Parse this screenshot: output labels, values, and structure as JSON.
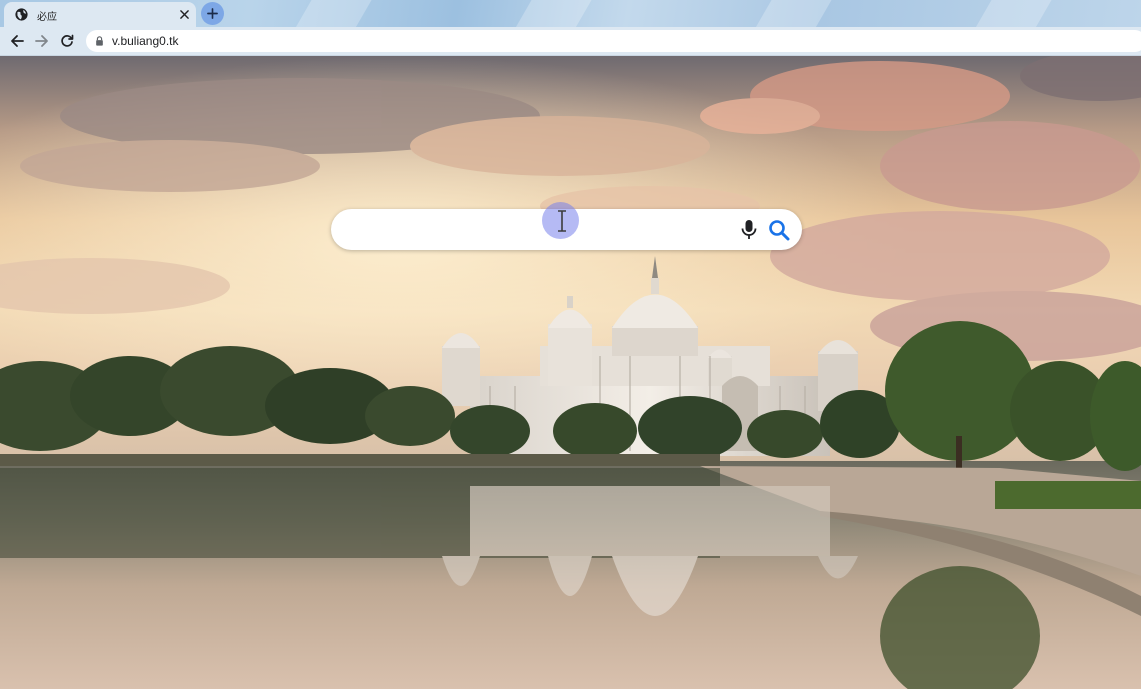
{
  "browser": {
    "tab": {
      "title": "必应",
      "favicon": "globe-icon",
      "close_icon": "close-icon"
    },
    "new_tab_icon": "plus-icon",
    "nav": {
      "back_icon": "arrow-left-icon",
      "forward_icon": "arrow-right-icon",
      "reload_icon": "reload-icon"
    },
    "address_bar": {
      "lock_icon": "lock-icon",
      "url": "v.buliang0.tk"
    }
  },
  "page": {
    "background": "palace-lake-sunset-photo",
    "search": {
      "value": "",
      "placeholder": "",
      "mic_icon": "microphone-icon",
      "search_icon": "search-icon"
    }
  },
  "colors": {
    "tab_strip": "#a8c8e4",
    "toolbar": "#dde8f2",
    "new_tab_button": "#7da7e6",
    "search_icon": "#1a73e8",
    "cursor_highlight": "#7882eb"
  }
}
